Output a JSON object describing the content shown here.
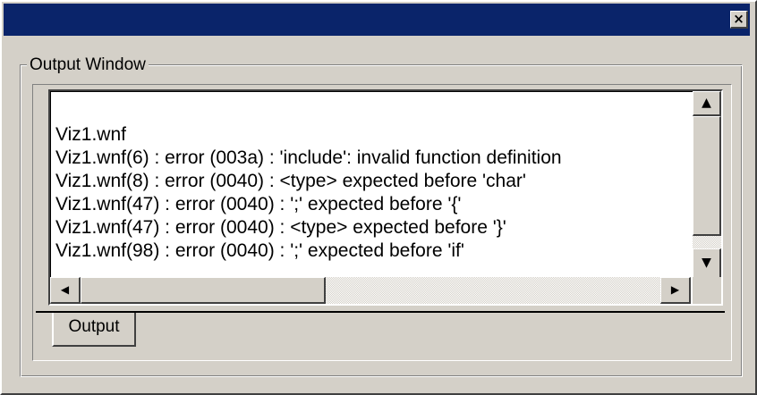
{
  "window": {
    "close_glyph": "×"
  },
  "group": {
    "label": "Output Window"
  },
  "output": {
    "lines": [
      "Viz1.wnf",
      "Viz1.wnf(6) : error (003a) : 'include': invalid function definition",
      "Viz1.wnf(8) : error (0040) : <type> expected before 'char'",
      "Viz1.wnf(47) : error (0040) : ';' expected before '{'",
      "Viz1.wnf(47) : error (0040) : <type> expected before '}'",
      "Viz1.wnf(98) : error (0040) : ';' expected before 'if'"
    ]
  },
  "scrollbars": {
    "up_glyph": "▲",
    "down_glyph": "▼",
    "left_glyph": "◀",
    "right_glyph": "▶"
  },
  "tabs": [
    {
      "label": "Output"
    }
  ]
}
